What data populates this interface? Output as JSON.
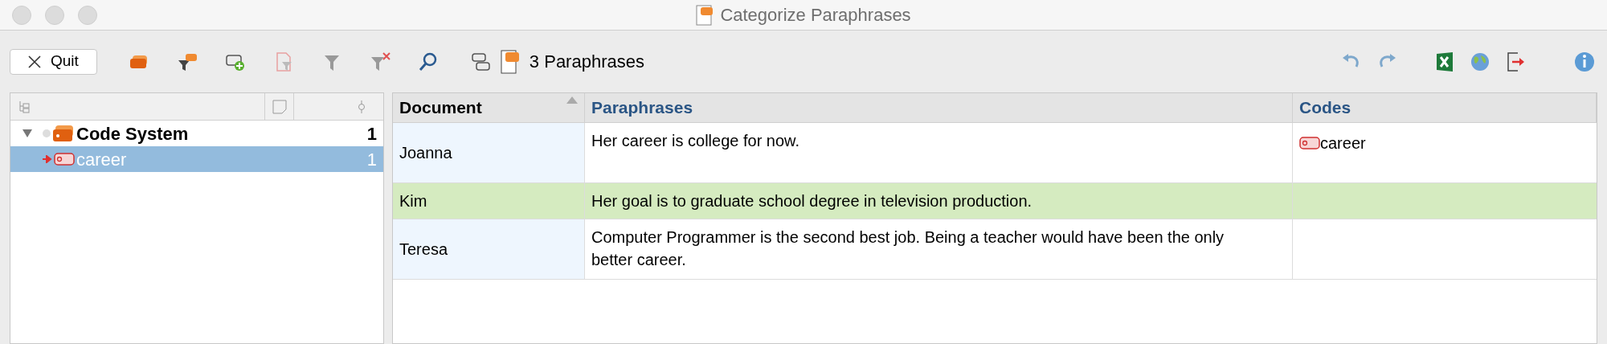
{
  "window": {
    "title": "Categorize Paraphrases"
  },
  "toolbar": {
    "quit": "Quit",
    "count": "3 Paraphrases"
  },
  "tree": {
    "items": [
      {
        "label": "Code System",
        "count": "1",
        "expanded": true,
        "selected": false,
        "kind": "root",
        "children": [
          {
            "label": "career",
            "count": "1",
            "selected": true,
            "kind": "code"
          }
        ]
      }
    ]
  },
  "table": {
    "columns": [
      "Document",
      "Paraphrases",
      "Codes"
    ],
    "rows": [
      {
        "document": "Joanna",
        "paraphrase": "Her career is college for now.",
        "codes": [
          "career"
        ],
        "selected": false
      },
      {
        "document": "Kim",
        "paraphrase": "Her goal is to graduate school degree in television production.",
        "codes": [],
        "selected": true
      },
      {
        "document": "Teresa",
        "paraphrase": "Computer Programmer is the second best job. Being a teacher would have been the only better career.",
        "codes": [],
        "selected": false
      }
    ]
  }
}
